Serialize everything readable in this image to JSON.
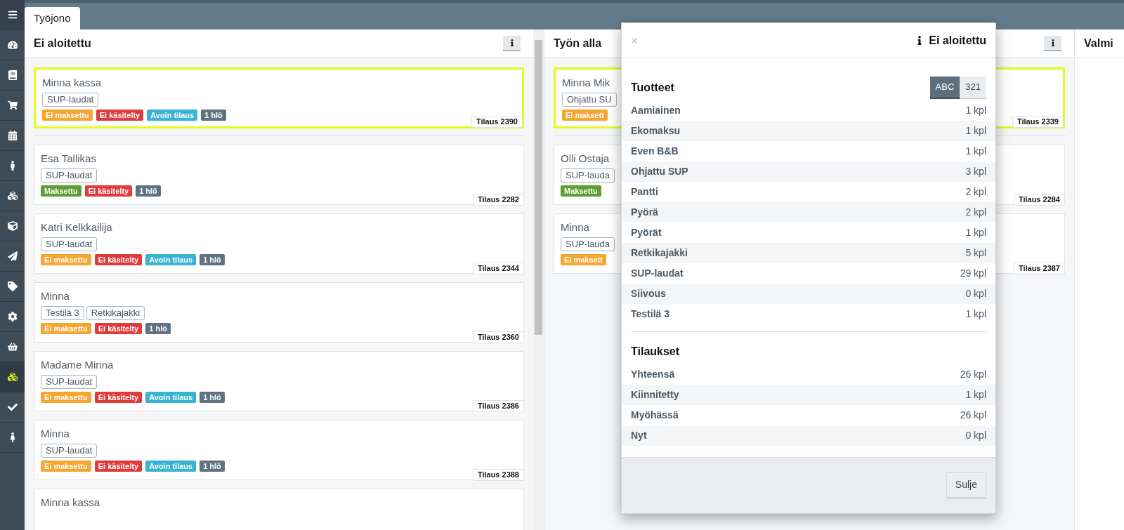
{
  "sidebar": {
    "items": [
      {
        "kind": "menu",
        "selected": false
      },
      {
        "kind": "dashboard",
        "selected": false
      },
      {
        "kind": "book",
        "selected": false
      },
      {
        "kind": "cart",
        "selected": false
      },
      {
        "kind": "calendar",
        "selected": false
      },
      {
        "kind": "person",
        "selected": false
      },
      {
        "kind": "cubes",
        "selected": false
      },
      {
        "kind": "cube",
        "selected": false
      },
      {
        "kind": "send",
        "selected": false
      },
      {
        "kind": "tag",
        "selected": false
      },
      {
        "kind": "settings",
        "selected": false
      },
      {
        "kind": "basket",
        "selected": false
      },
      {
        "kind": "cubes",
        "selected": true
      },
      {
        "kind": "check",
        "selected": false
      },
      {
        "kind": "woman",
        "selected": false
      }
    ]
  },
  "tabs": [
    {
      "label": "Työjono",
      "selected": true
    }
  ],
  "columns": [
    {
      "title": "Ei aloitettu",
      "cards": [
        {
          "name": "Minna kassa",
          "selected": true,
          "products": [
            "SUP-laudat"
          ],
          "tags": [
            {
              "label": "Ei maksettu",
              "color": "#f6a531"
            },
            {
              "label": "Ei käsitelty",
              "color": "#e03b3b"
            },
            {
              "label": "Avoin tilaus",
              "color": "#38b3d4"
            },
            {
              "label": "1 hlö",
              "color": "#5f7282"
            }
          ],
          "order": "Tilaus 2390"
        },
        {
          "name": "Esa Tallikas",
          "selected": false,
          "products": [
            "SUP-laudat"
          ],
          "tags": [
            {
              "label": "Maksettu",
              "color": "#5c9e2f"
            },
            {
              "label": "Ei käsitelty",
              "color": "#e03b3b"
            },
            {
              "label": "1 hlö",
              "color": "#5f7282"
            }
          ],
          "order": "Tilaus 2282"
        },
        {
          "name": "Katri Kelkkailija",
          "selected": false,
          "products": [
            "SUP-laudat"
          ],
          "tags": [
            {
              "label": "Ei maksettu",
              "color": "#f6a531"
            },
            {
              "label": "Ei käsitelty",
              "color": "#e03b3b"
            },
            {
              "label": "Avoin tilaus",
              "color": "#38b3d4"
            },
            {
              "label": "1 hlö",
              "color": "#5f7282"
            }
          ],
          "order": "Tilaus 2344"
        },
        {
          "name": "Minna",
          "selected": false,
          "products": [
            "Testilä 3",
            "Retkikajakki"
          ],
          "tags": [
            {
              "label": "Ei maksettu",
              "color": "#f6a531"
            },
            {
              "label": "Ei käsitelty",
              "color": "#e03b3b"
            },
            {
              "label": "1 hlö",
              "color": "#5f7282"
            }
          ],
          "order": "Tilaus 2360"
        },
        {
          "name": "Madame Minna",
          "selected": false,
          "products": [
            "SUP-laudat"
          ],
          "tags": [
            {
              "label": "Ei maksettu",
              "color": "#f6a531"
            },
            {
              "label": "Ei käsitelty",
              "color": "#e03b3b"
            },
            {
              "label": "Avoin tilaus",
              "color": "#38b3d4"
            },
            {
              "label": "1 hlö",
              "color": "#5f7282"
            }
          ],
          "order": "Tilaus 2386"
        },
        {
          "name": "Minna",
          "selected": false,
          "products": [
            "SUP-laudat"
          ],
          "tags": [
            {
              "label": "Ei maksettu",
              "color": "#f6a531"
            },
            {
              "label": "Ei käsitelty",
              "color": "#e03b3b"
            },
            {
              "label": "Avoin tilaus",
              "color": "#38b3d4"
            },
            {
              "label": "1 hlö",
              "color": "#5f7282"
            }
          ],
          "order": "Tilaus 2388"
        },
        {
          "name": "Minna kassa",
          "selected": false
        }
      ]
    },
    {
      "title": "Työn alla",
      "cards": [
        {
          "name": "Minna Mik",
          "selected": true,
          "products": [
            "Ohjattu SU"
          ],
          "tags": [
            {
              "label": "Ei maksett",
              "color": "#f6a531"
            }
          ],
          "order": "Tilaus 2339"
        },
        {
          "name": "Olli Ostaja",
          "selected": false,
          "products": [
            "SUP-lauda"
          ],
          "tags": [
            {
              "label": "Maksettu",
              "color": "#5c9e2f"
            }
          ],
          "order": "Tilaus 2284"
        },
        {
          "name": "Minna",
          "selected": false,
          "products": [
            "SUP-lauda"
          ],
          "tags": [
            {
              "label": "Ei maksett",
              "color": "#f6a531"
            }
          ],
          "order": "Tilaus 2387"
        }
      ]
    },
    {
      "title": "Valmi"
    }
  ],
  "modal": {
    "close": "×",
    "title": "Ei aloitettu",
    "sections": [
      {
        "title": "Tuotteet",
        "sort_options": [
          {
            "label": "ABC",
            "selected": true
          },
          {
            "label": "321",
            "selected": false
          }
        ],
        "rows": [
          {
            "label": "Aamiainen",
            "value": "1 kpl"
          },
          {
            "label": "Ekomaksu",
            "value": "1 kpl"
          },
          {
            "label": "Even B&B",
            "value": "1 kpl"
          },
          {
            "label": "Ohjattu SUP",
            "value": "3 kpl"
          },
          {
            "label": "Pantti",
            "value": "2 kpl"
          },
          {
            "label": "Pyörä",
            "value": "2 kpl"
          },
          {
            "label": "Pyörät",
            "value": "1 kpl"
          },
          {
            "label": "Retkikajakki",
            "value": "5 kpl"
          },
          {
            "label": "SUP-laudat",
            "value": "29 kpl"
          },
          {
            "label": "Siivous",
            "value": "0 kpl"
          },
          {
            "label": "Testilä 3",
            "value": "1 kpl"
          }
        ]
      },
      {
        "title": "Tilaukset",
        "rows": [
          {
            "label": "Yhteensä",
            "value": "26 kpl"
          },
          {
            "label": "Kiinnitetty",
            "value": "1 kpl"
          },
          {
            "label": "Myöhässä",
            "value": "26 kpl"
          },
          {
            "label": "Nyt",
            "value": "0 kpl"
          }
        ]
      }
    ],
    "button": "Sulje"
  }
}
